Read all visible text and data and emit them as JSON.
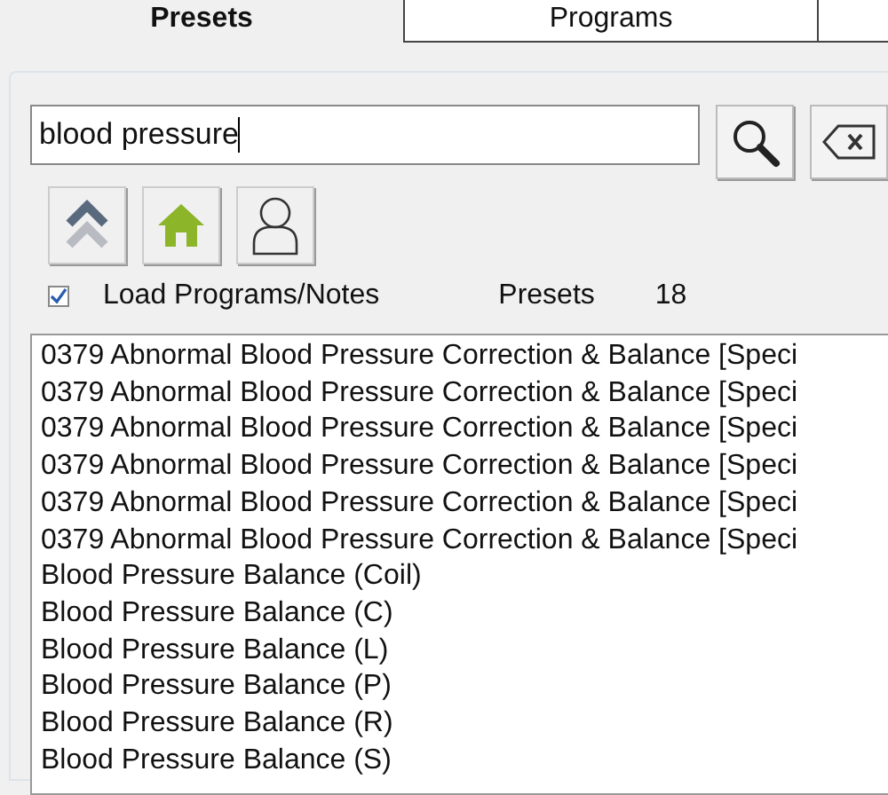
{
  "tabs": [
    {
      "label": "Presets",
      "selected": true
    },
    {
      "label": "Programs",
      "selected": false
    },
    {
      "selected": false
    }
  ],
  "search": {
    "value": "blood pressure"
  },
  "load_programs": {
    "label": "Load Programs/Notes",
    "checked": true
  },
  "presets_count": {
    "label": "Presets",
    "value": "18"
  },
  "results": [
    "0379 Abnormal Blood Pressure Correction & Balance [Speci",
    "0379 Abnormal Blood Pressure Correction & Balance [Speci",
    "0379 Abnormal Blood Pressure Correction & Balance [Speci",
    "0379 Abnormal Blood Pressure Correction & Balance [Speci",
    "0379 Abnormal Blood Pressure Correction & Balance [Speci",
    "0379 Abnormal Blood Pressure Correction & Balance [Speci",
    "Blood Pressure Balance (Coil)",
    "Blood Pressure Balance (C)",
    "Blood Pressure Balance (L)",
    "Blood Pressure Balance (P)",
    "Blood Pressure Balance (R)",
    "Blood Pressure Balance (S)"
  ]
}
